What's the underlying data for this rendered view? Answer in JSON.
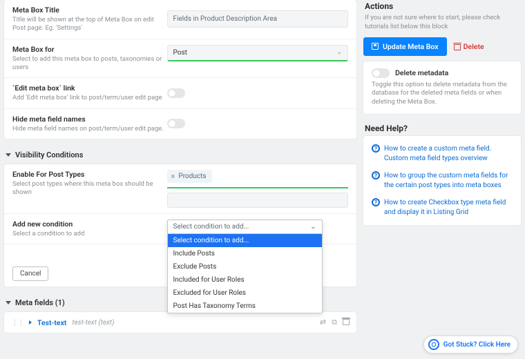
{
  "main": {
    "settings": {
      "title": {
        "label": "Meta Box Title",
        "desc": "Title will be shown at the top of Meta Box on edit Post page. Eg. 'Settings'",
        "value": "Fields in Product Description Area"
      },
      "for": {
        "label": "Meta Box for",
        "desc": "Select to add this meta box to posts, taxonomies or users",
        "value": "Post"
      },
      "editlink": {
        "label": "`Edit meta box` link",
        "desc": "Add 'Edit meta box' link to post/term/user edit page"
      },
      "hidenames": {
        "label": "Hide meta field names",
        "desc": "Hide meta field names on post/term/user edit page."
      }
    },
    "visibility": {
      "heading": "Visibility Conditions",
      "enable": {
        "label": "Enable For Post Types",
        "desc": "Select post types where this meta box should be shown",
        "tag": "Products"
      },
      "add": {
        "label": "Add new condition",
        "desc": "Select a condition to add",
        "placeholder": "Select condition to add...",
        "options": [
          "Select condition to add...",
          "Include Posts",
          "Exclude Posts",
          "Included for User Roles",
          "Excluded for User Roles",
          "Post Has Taxonomy Terms"
        ]
      },
      "cancel": "Cancel"
    },
    "metafields": {
      "heading": "Meta fields (1)",
      "item": {
        "name": "Test-text",
        "slug": "test-text (text)"
      }
    }
  },
  "side": {
    "actions": {
      "heading": "Actions",
      "note": "If you are not sure where to start, please check tutorials list below this block",
      "update": "Update Meta Box",
      "delete": "Delete"
    },
    "deletemeta": {
      "title": "Delete metadata",
      "desc": "Toggle this option to delete metadata from the database for the deleted meta fields or when deleting the Meta Box."
    },
    "help": {
      "heading": "Need Help?",
      "links": [
        "How to create a custom meta field. Custom meta field types overview",
        "How to group the custom meta fields for the certain post types into meta boxes",
        "How to create Checkbox type meta field and display it in Listing Grid"
      ]
    }
  },
  "stuck": "Got Stuck? Click Here"
}
